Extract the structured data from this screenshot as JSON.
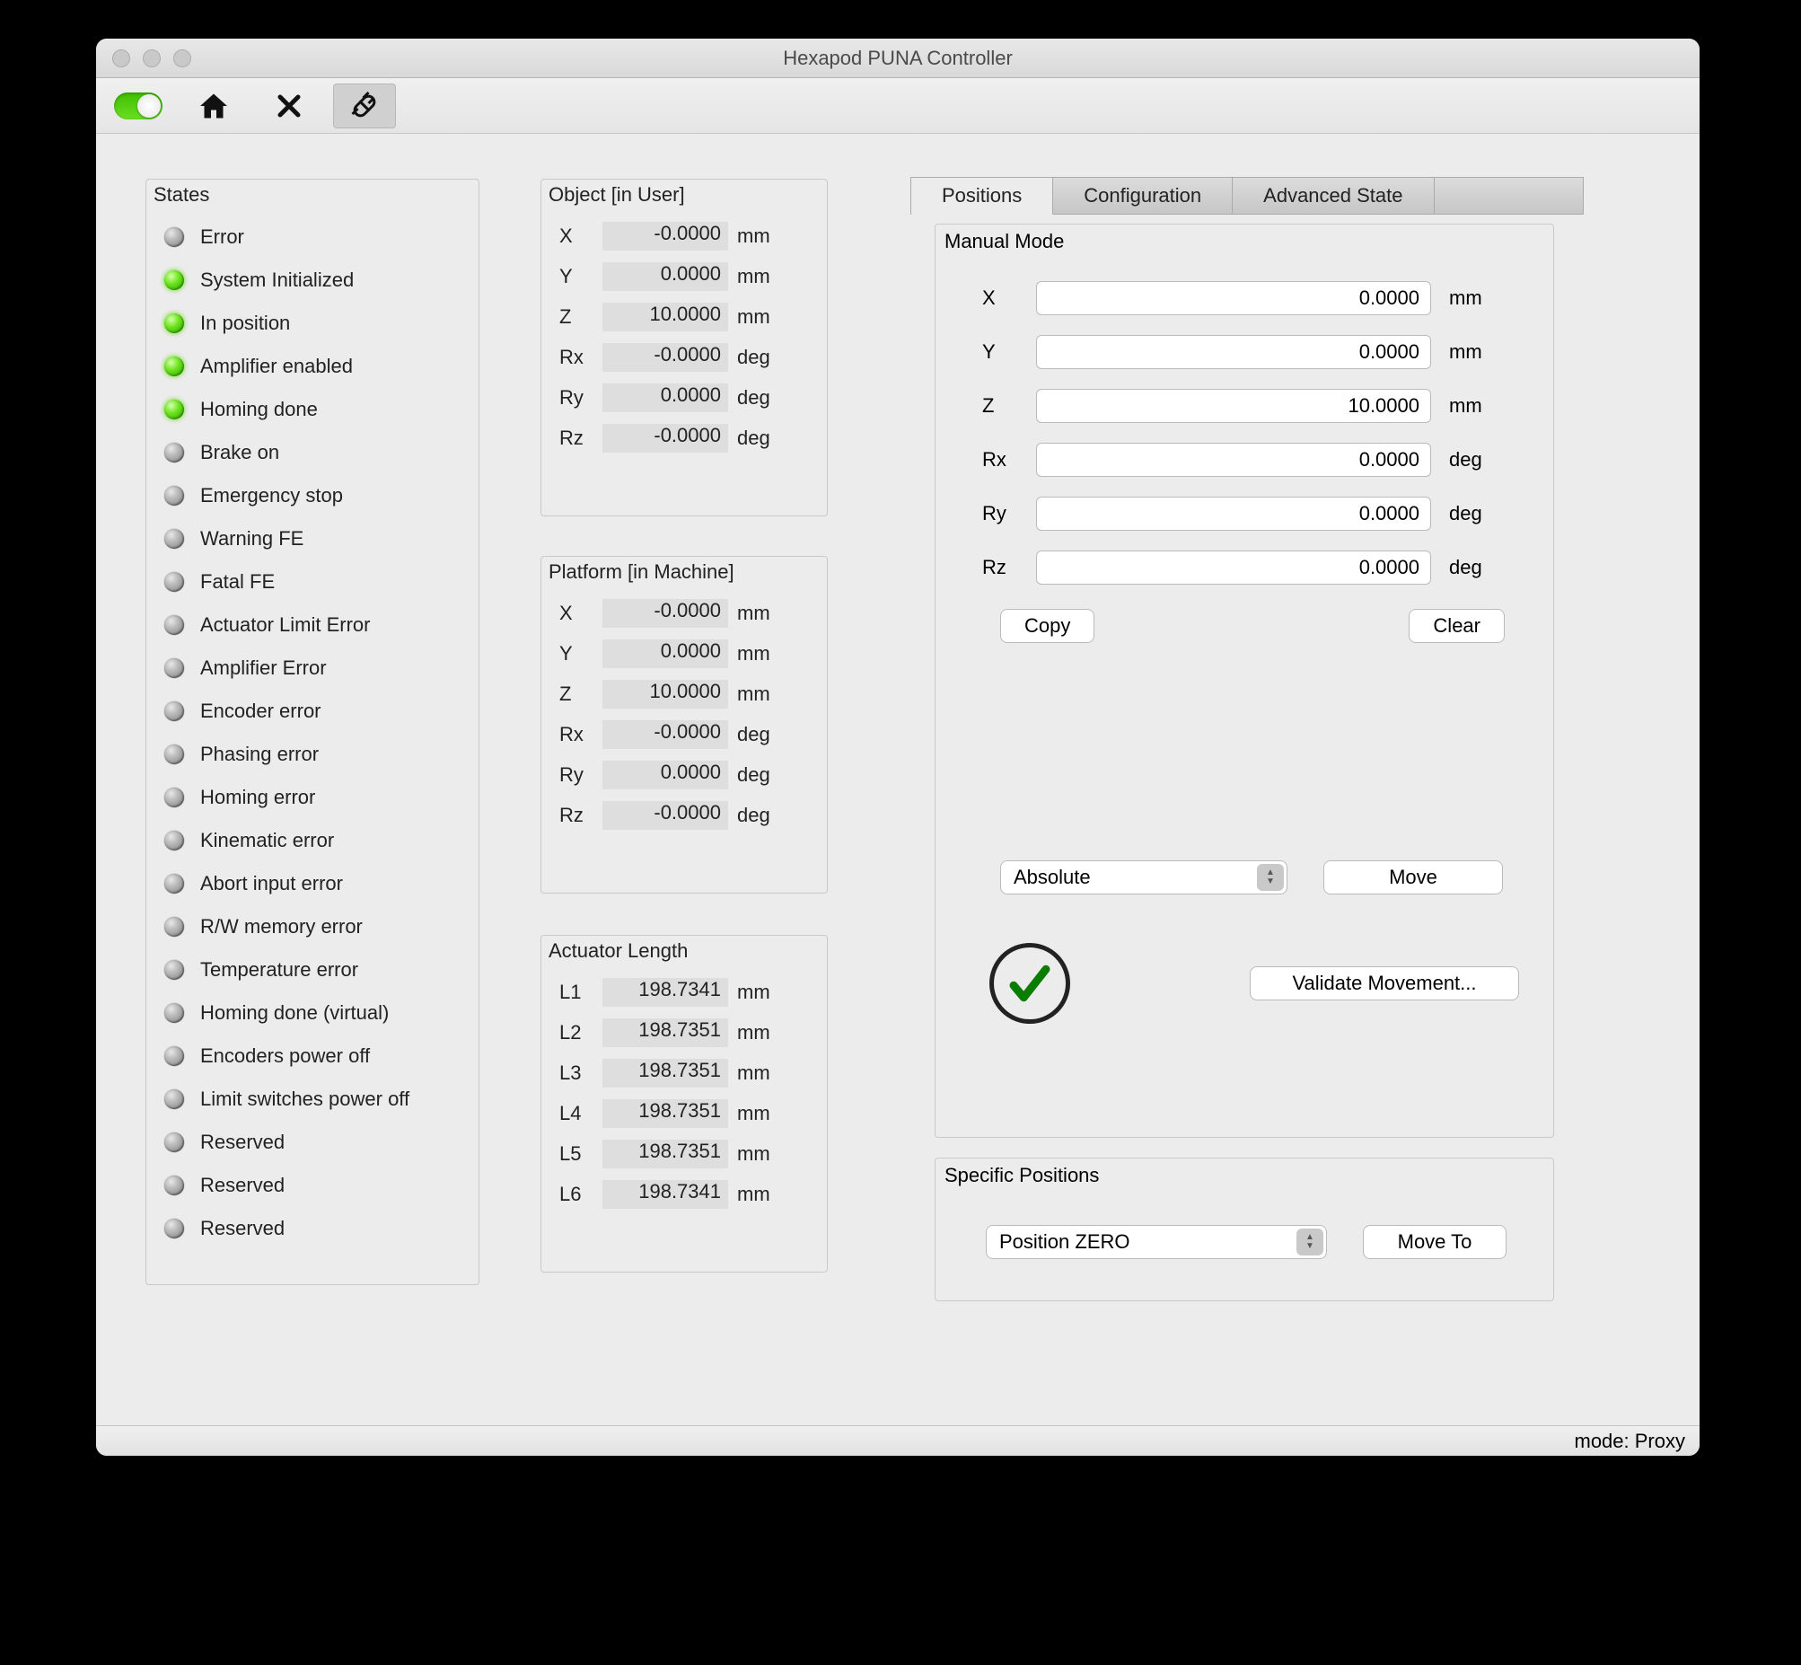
{
  "window": {
    "title": "Hexapod PUNA Controller"
  },
  "status_bar": {
    "text": "mode: Proxy"
  },
  "tabs": {
    "positions": "Positions",
    "configuration": "Configuration",
    "advanced": "Advanced State"
  },
  "states": {
    "title": "States",
    "items": [
      {
        "label": "Error",
        "on": false
      },
      {
        "label": "System Initialized",
        "on": true
      },
      {
        "label": "In position",
        "on": true
      },
      {
        "label": "Amplifier enabled",
        "on": true
      },
      {
        "label": "Homing done",
        "on": true
      },
      {
        "label": "Brake on",
        "on": false
      },
      {
        "label": "Emergency stop",
        "on": false
      },
      {
        "label": "Warning FE",
        "on": false
      },
      {
        "label": "Fatal FE",
        "on": false
      },
      {
        "label": "Actuator Limit Error",
        "on": false
      },
      {
        "label": "Amplifier Error",
        "on": false
      },
      {
        "label": "Encoder error",
        "on": false
      },
      {
        "label": "Phasing error",
        "on": false
      },
      {
        "label": "Homing error",
        "on": false
      },
      {
        "label": "Kinematic error",
        "on": false
      },
      {
        "label": "Abort input error",
        "on": false
      },
      {
        "label": "R/W memory error",
        "on": false
      },
      {
        "label": "Temperature error",
        "on": false
      },
      {
        "label": "Homing done (virtual)",
        "on": false
      },
      {
        "label": "Encoders power off",
        "on": false
      },
      {
        "label": "Limit switches power off",
        "on": false
      },
      {
        "label": "Reserved",
        "on": false
      },
      {
        "label": "Reserved",
        "on": false
      },
      {
        "label": "Reserved",
        "on": false
      }
    ]
  },
  "object_user": {
    "title": "Object [in User]",
    "rows": [
      {
        "lbl": "X",
        "val": "-0.0000",
        "unit": "mm"
      },
      {
        "lbl": "Y",
        "val": "0.0000",
        "unit": "mm"
      },
      {
        "lbl": "Z",
        "val": "10.0000",
        "unit": "mm"
      },
      {
        "lbl": "Rx",
        "val": "-0.0000",
        "unit": "deg"
      },
      {
        "lbl": "Ry",
        "val": "0.0000",
        "unit": "deg"
      },
      {
        "lbl": "Rz",
        "val": "-0.0000",
        "unit": "deg"
      }
    ]
  },
  "platform_machine": {
    "title": "Platform [in Machine]",
    "rows": [
      {
        "lbl": "X",
        "val": "-0.0000",
        "unit": "mm"
      },
      {
        "lbl": "Y",
        "val": "0.0000",
        "unit": "mm"
      },
      {
        "lbl": "Z",
        "val": "10.0000",
        "unit": "mm"
      },
      {
        "lbl": "Rx",
        "val": "-0.0000",
        "unit": "deg"
      },
      {
        "lbl": "Ry",
        "val": "0.0000",
        "unit": "deg"
      },
      {
        "lbl": "Rz",
        "val": "-0.0000",
        "unit": "deg"
      }
    ]
  },
  "actuator": {
    "title": "Actuator Length",
    "rows": [
      {
        "lbl": "L1",
        "val": "198.7341",
        "unit": "mm"
      },
      {
        "lbl": "L2",
        "val": "198.7351",
        "unit": "mm"
      },
      {
        "lbl": "L3",
        "val": "198.7351",
        "unit": "mm"
      },
      {
        "lbl": "L4",
        "val": "198.7351",
        "unit": "mm"
      },
      {
        "lbl": "L5",
        "val": "198.7351",
        "unit": "mm"
      },
      {
        "lbl": "L6",
        "val": "198.7341",
        "unit": "mm"
      }
    ]
  },
  "manual": {
    "title": "Manual Mode",
    "rows": [
      {
        "lbl": "X",
        "val": "0.0000",
        "unit": "mm"
      },
      {
        "lbl": "Y",
        "val": "0.0000",
        "unit": "mm"
      },
      {
        "lbl": "Z",
        "val": "10.0000",
        "unit": "mm"
      },
      {
        "lbl": "Rx",
        "val": "0.0000",
        "unit": "deg"
      },
      {
        "lbl": "Ry",
        "val": "0.0000",
        "unit": "deg"
      },
      {
        "lbl": "Rz",
        "val": "0.0000",
        "unit": "deg"
      }
    ],
    "copy": "Copy",
    "clear": "Clear",
    "mode_select": "Absolute",
    "move": "Move",
    "validate": "Validate Movement..."
  },
  "specific": {
    "title": "Specific Positions",
    "select": "Position ZERO",
    "move_to": "Move To"
  }
}
